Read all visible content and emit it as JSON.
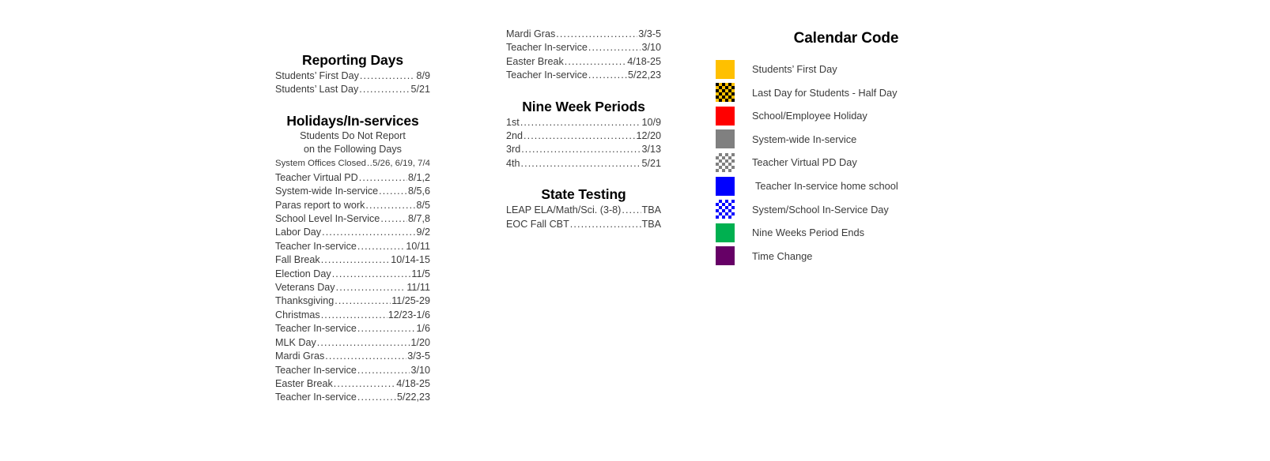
{
  "reporting": {
    "title": "Reporting Days",
    "entries": [
      {
        "label": "Students’ First Day",
        "value": "8/9"
      },
      {
        "label": "Students’ Last Day",
        "value": "5/21"
      }
    ]
  },
  "holidays": {
    "title": "Holidays/In-services",
    "subnote_line1": "Students Do Not Report",
    "subnote_line2": "on the Following Days",
    "entries": [
      {
        "label": "System Offices Closed",
        "value": "5/26, 6/19, 7/4",
        "small": true
      },
      {
        "label": "Teacher Virtual PD",
        "value": "8/1,2"
      },
      {
        "label": "System-wide In-service",
        "value": "8/5,6"
      },
      {
        "label": "Paras report to work",
        "value": "8/5"
      },
      {
        "label": "School Level In-Service",
        "value": "8/7,8"
      },
      {
        "label": "Labor Day",
        "value": "9/2"
      },
      {
        "label": "Teacher In-service",
        "value": "10/11"
      },
      {
        "label": "Fall Break",
        "value": "10/14-15"
      },
      {
        "label": "Election Day",
        "value": "11/5"
      },
      {
        "label": "Veterans Day",
        "value": "11/11"
      },
      {
        "label": "Thanksgiving",
        "value": "11/25-29"
      },
      {
        "label": "Christmas",
        "value": "12/23-1/6"
      },
      {
        "label": "Teacher In-service",
        "value": "1/6"
      },
      {
        "label": "MLK Day",
        "value": "1/20"
      },
      {
        "label": "Mardi Gras",
        "value": "3/3-5"
      },
      {
        "label": "Teacher In-service",
        "value": "3/10"
      },
      {
        "label": "Easter Break",
        "value": "4/18-25"
      },
      {
        "label": "Teacher In-service",
        "value": "5/22,23"
      }
    ]
  },
  "holidays_continued": {
    "entries": [
      {
        "label": "Mardi Gras",
        "value": "3/3-5"
      },
      {
        "label": "Teacher In-service",
        "value": "3/10"
      },
      {
        "label": "Easter Break",
        "value": "4/18-25"
      },
      {
        "label": "Teacher In-service",
        "value": "5/22,23"
      }
    ]
  },
  "nine_week_periods": {
    "title": "Nine Week Periods",
    "entries": [
      {
        "label": "1st",
        "value": "10/9"
      },
      {
        "label": "2nd",
        "value": "12/20"
      },
      {
        "label": "3rd",
        "value": "3/13"
      },
      {
        "label": "4th",
        "value": "5/21"
      }
    ]
  },
  "state_testing": {
    "title": "State Testing",
    "entries": [
      {
        "label": "LEAP ELA/Math/Sci. (3-8)",
        "value": "TBA"
      },
      {
        "label": "EOC Fall CBT",
        "value": "TBA"
      }
    ]
  },
  "calendar_code": {
    "title": "Calendar Code",
    "items": [
      {
        "label": "Students’ First Day",
        "style": "solid",
        "color": "#FFC000",
        "alt": "#000000",
        "indent": false
      },
      {
        "label": "Last Day for Students - Half Day",
        "style": "check",
        "color": "#FFC000",
        "alt": "#000000",
        "indent": false
      },
      {
        "label": "School/Employee Holiday",
        "style": "solid",
        "color": "#FF0000",
        "alt": "#000000",
        "indent": false
      },
      {
        "label": "System-wide In-service",
        "style": "solid",
        "color": "#808080",
        "alt": "#000000",
        "indent": false
      },
      {
        "label": "Teacher Virtual PD Day",
        "style": "check",
        "color": "#808080",
        "alt": "#FFFFFF",
        "indent": false
      },
      {
        "label": "Teacher In-service home school",
        "style": "solid",
        "color": "#0000FF",
        "alt": "#000000",
        "indent": true
      },
      {
        "label": "System/School In-Service Day",
        "style": "check",
        "color": "#0000FF",
        "alt": "#FFFFFF",
        "indent": false
      },
      {
        "label": "Nine Weeks Period Ends",
        "style": "solid",
        "color": "#00B050",
        "alt": "#000000",
        "indent": false
      },
      {
        "label": "Time Change",
        "style": "solid",
        "color": "#660066",
        "alt": "#000000",
        "indent": false
      }
    ]
  },
  "leader_dots": "......................................................................................"
}
